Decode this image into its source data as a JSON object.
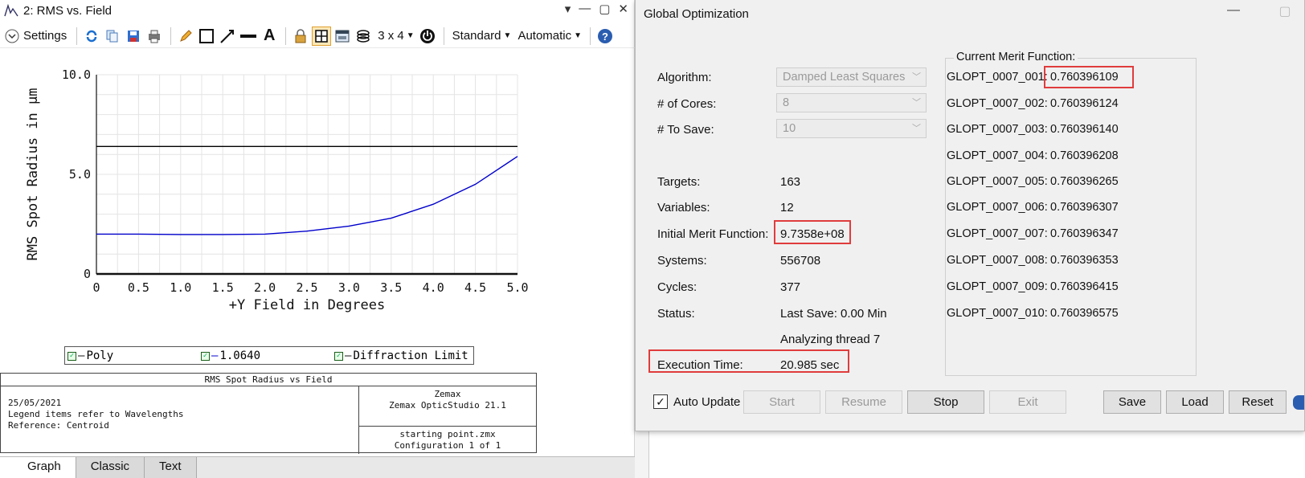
{
  "left_window": {
    "title": "2: RMS vs. Field",
    "toolbar": {
      "settings_label": "Settings",
      "layout_label": "3 x 4",
      "standard_label": "Standard",
      "automatic_label": "Automatic"
    },
    "legend": {
      "items": [
        "Poly",
        "1.0640",
        "Diffraction Limit"
      ]
    },
    "infobox": {
      "title": "RMS Spot Radius vs Field",
      "left_lines": [
        "25/05/2021",
        "Legend items refer to Wavelengths",
        "Reference: Centroid"
      ],
      "right_top": [
        "Zemax",
        "Zemax OpticStudio 21.1"
      ],
      "right_bottom": [
        "starting point.zmx",
        "Configuration 1 of 1"
      ]
    },
    "tabs": [
      "Graph",
      "Classic",
      "Text"
    ]
  },
  "chart_data": {
    "type": "line",
    "title": "",
    "xlabel": "+Y Field in Degrees",
    "ylabel": "RMS Spot Radius in µm",
    "xlim": [
      0,
      5.0
    ],
    "ylim": [
      0,
      10.0
    ],
    "x_ticks": [
      "0",
      "0.5",
      "1.0",
      "1.5",
      "2.0",
      "2.5",
      "3.0",
      "3.5",
      "4.0",
      "4.5",
      "5.0"
    ],
    "y_ticks": [
      "0",
      "5.0",
      "10.0"
    ],
    "grid": true,
    "series": [
      {
        "name": "1.0640",
        "color": "#0000cc",
        "x": [
          0,
          0.5,
          1.0,
          1.5,
          2.0,
          2.5,
          3.0,
          3.5,
          4.0,
          4.5,
          5.0
        ],
        "y": [
          2.0,
          2.0,
          1.98,
          1.98,
          2.0,
          2.15,
          2.4,
          2.8,
          3.5,
          4.5,
          5.9
        ]
      },
      {
        "name": "Diffraction Limit",
        "color": "#000000",
        "x": [
          0,
          5.0
        ],
        "y": [
          6.4,
          6.4
        ]
      }
    ]
  },
  "dialog": {
    "title": "Global Optimization",
    "algorithm_label": "Algorithm:",
    "algorithm_value": "Damped Least Squares",
    "cores_label": "# of Cores:",
    "cores_value": "8",
    "tosave_label": "# To Save:",
    "tosave_value": "10",
    "targets_label": "Targets:",
    "targets_value": "163",
    "variables_label": "Variables:",
    "variables_value": "12",
    "imf_label": "Initial Merit Function:",
    "imf_value": "9.7358e+08",
    "systems_label": "Systems:",
    "systems_value": "556708",
    "cycles_label": "Cycles:",
    "cycles_value": "377",
    "status_label": "Status:",
    "status_value": "Last Save: 0.00 Min",
    "status_value2": "Analyzing thread 7",
    "exec_label": "Execution Time:",
    "exec_value": "20.985 sec",
    "merit_title": "Current Merit Function:",
    "merit": [
      {
        "name": "GLOPT_0007_001:",
        "value": "0.760396109"
      },
      {
        "name": "GLOPT_0007_002:",
        "value": "0.760396124"
      },
      {
        "name": "GLOPT_0007_003:",
        "value": "0.760396140"
      },
      {
        "name": "GLOPT_0007_004:",
        "value": "0.760396208"
      },
      {
        "name": "GLOPT_0007_005:",
        "value": "0.760396265"
      },
      {
        "name": "GLOPT_0007_006:",
        "value": "0.760396307"
      },
      {
        "name": "GLOPT_0007_007:",
        "value": "0.760396347"
      },
      {
        "name": "GLOPT_0007_008:",
        "value": "0.760396353"
      },
      {
        "name": "GLOPT_0007_009:",
        "value": "0.760396415"
      },
      {
        "name": "GLOPT_0007_010:",
        "value": "0.760396575"
      }
    ],
    "auto_update_label": "Auto Update",
    "auto_update_checked": true,
    "buttons": {
      "start": "Start",
      "resume": "Resume",
      "stop": "Stop",
      "exit": "Exit",
      "save": "Save",
      "load": "Load",
      "reset": "Reset"
    }
  }
}
